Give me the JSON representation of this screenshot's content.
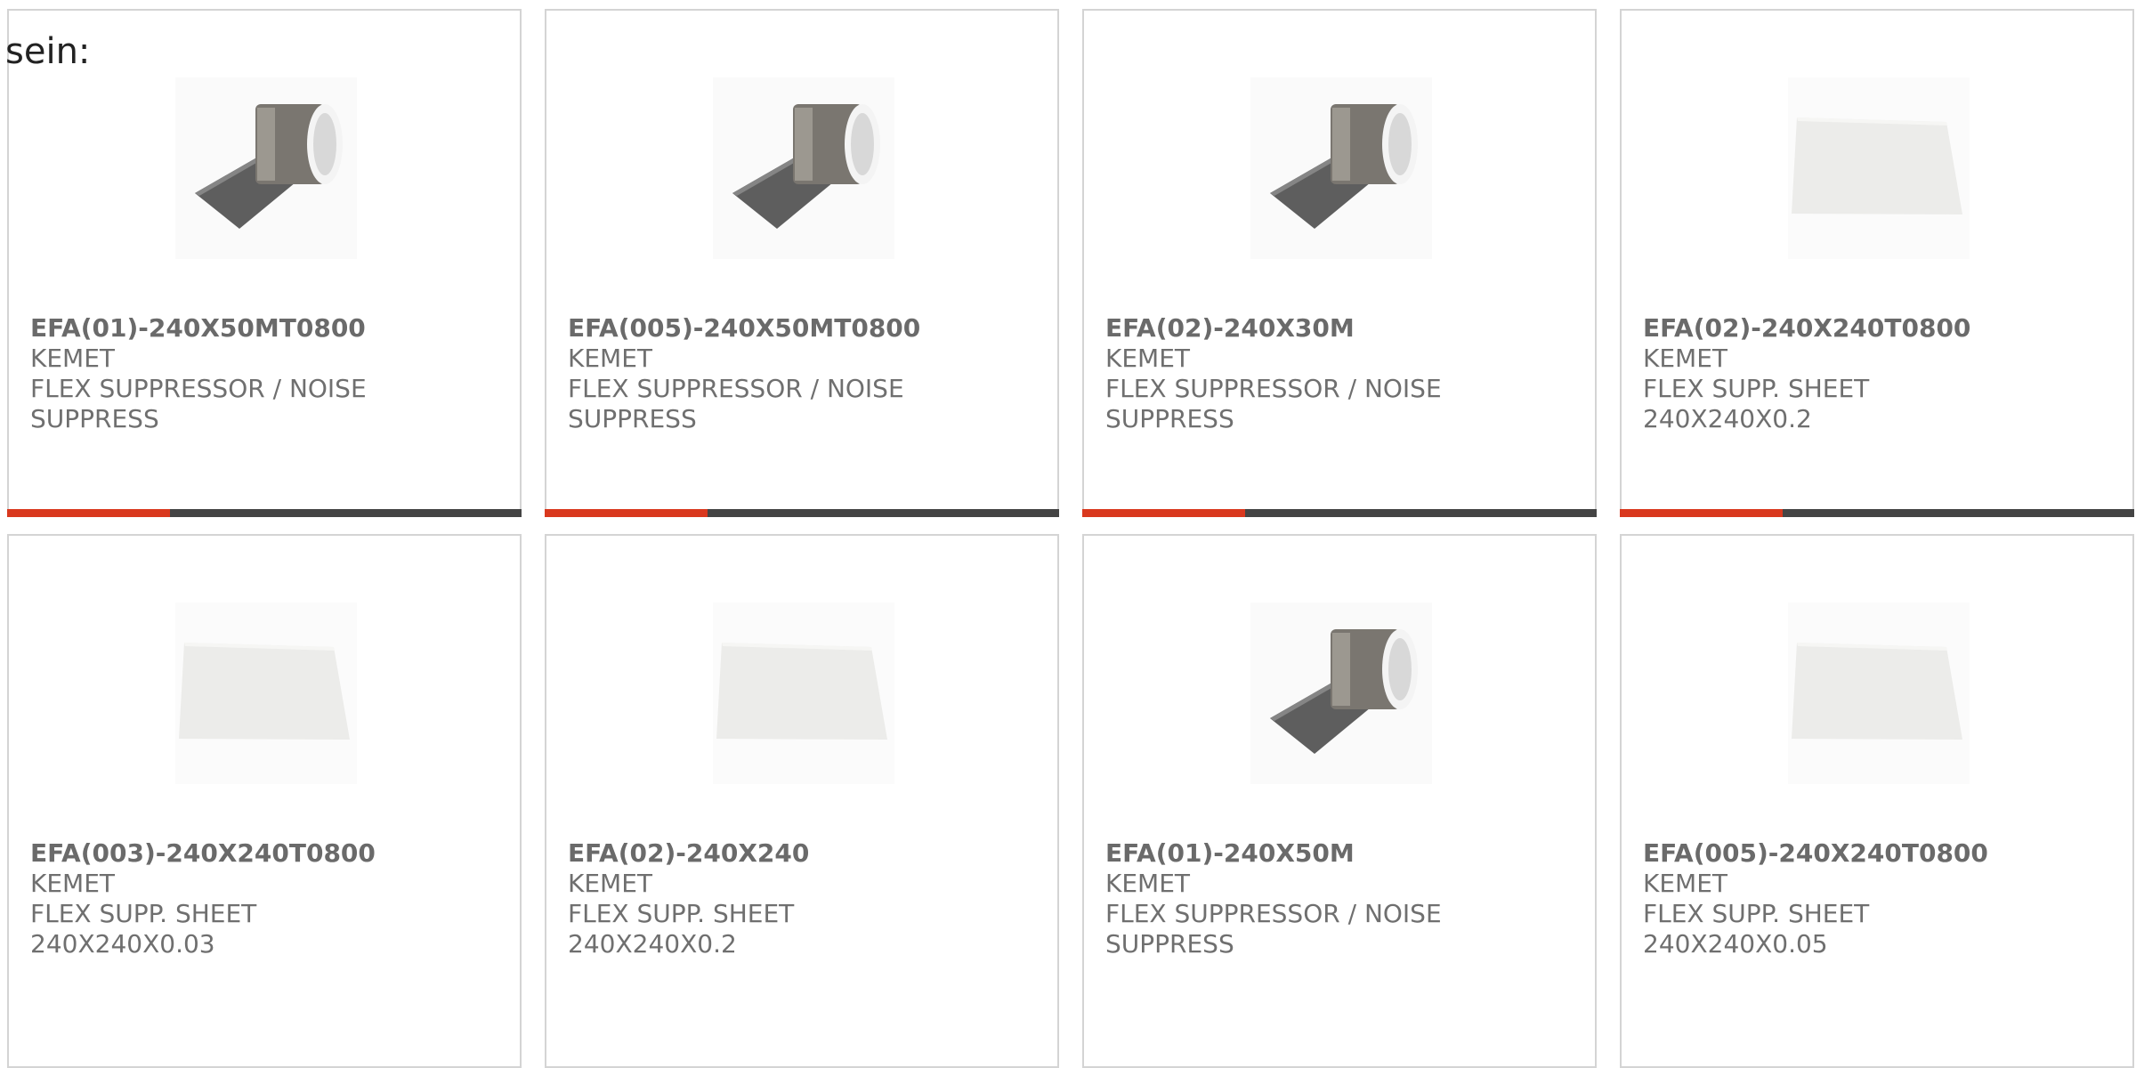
{
  "intro_text": "sein:",
  "colors": {
    "accent": "#d9381e",
    "bar_dark": "#444444",
    "card_border": "#d4d4d4"
  },
  "products": [
    {
      "part_number": "EFA(01)-240X50MT0800",
      "manufacturer": "KEMET",
      "description": "FLEX SUPPRESSOR / NOISE SUPPRESS",
      "image": "roll-image"
    },
    {
      "part_number": "EFA(005)-240X50MT0800",
      "manufacturer": "KEMET",
      "description": "FLEX SUPPRESSOR / NOISE SUPPRESS",
      "image": "roll-image"
    },
    {
      "part_number": "EFA(02)-240X30M",
      "manufacturer": "KEMET",
      "description": "FLEX SUPPRESSOR / NOISE SUPPRESS",
      "image": "roll-image"
    },
    {
      "part_number": "EFA(02)-240X240T0800",
      "manufacturer": "KEMET",
      "description": "FLEX SUPP. SHEET 240X240X0.2",
      "image": "sheet-image"
    },
    {
      "part_number": "EFA(003)-240X240T0800",
      "manufacturer": "KEMET",
      "description": "FLEX SUPP. SHEET 240X240X0.03",
      "image": "sheet-image"
    },
    {
      "part_number": "EFA(02)-240X240",
      "manufacturer": "KEMET",
      "description": "FLEX SUPP. SHEET 240X240X0.2",
      "image": "sheet-image"
    },
    {
      "part_number": "EFA(01)-240X50M",
      "manufacturer": "KEMET",
      "description": "FLEX SUPPRESSOR / NOISE SUPPRESS",
      "image": "roll-image"
    },
    {
      "part_number": "EFA(005)-240X240T0800",
      "manufacturer": "KEMET",
      "description": "FLEX SUPP. SHEET 240X240X0.05",
      "image": "sheet-image"
    }
  ]
}
